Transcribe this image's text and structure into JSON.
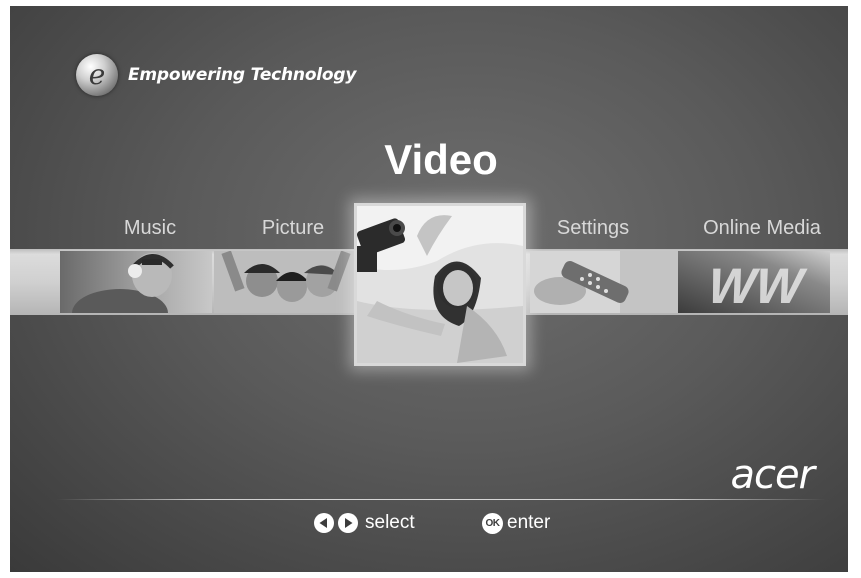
{
  "brand": {
    "logo_icon": "e-globe-icon",
    "tagline": "Empowering Technology"
  },
  "title": "Video",
  "menu": {
    "selected_index": 2,
    "items": [
      {
        "label": "Music",
        "thumb": "headphones-listener-photo"
      },
      {
        "label": "Picture",
        "thumb": "group-of-friends-photo"
      },
      {
        "label": "Video",
        "thumb": "woman-with-camcorder-photo"
      },
      {
        "label": "Settings",
        "thumb": "remote-control-photo"
      },
      {
        "label": "Online Media",
        "thumb": "www-photo"
      }
    ]
  },
  "footer": {
    "brand": "acer",
    "select_hint": "select",
    "enter_hint": "enter",
    "ok_label": "OK",
    "left_icon": "arrow-left-icon",
    "right_icon": "arrow-right-icon"
  }
}
